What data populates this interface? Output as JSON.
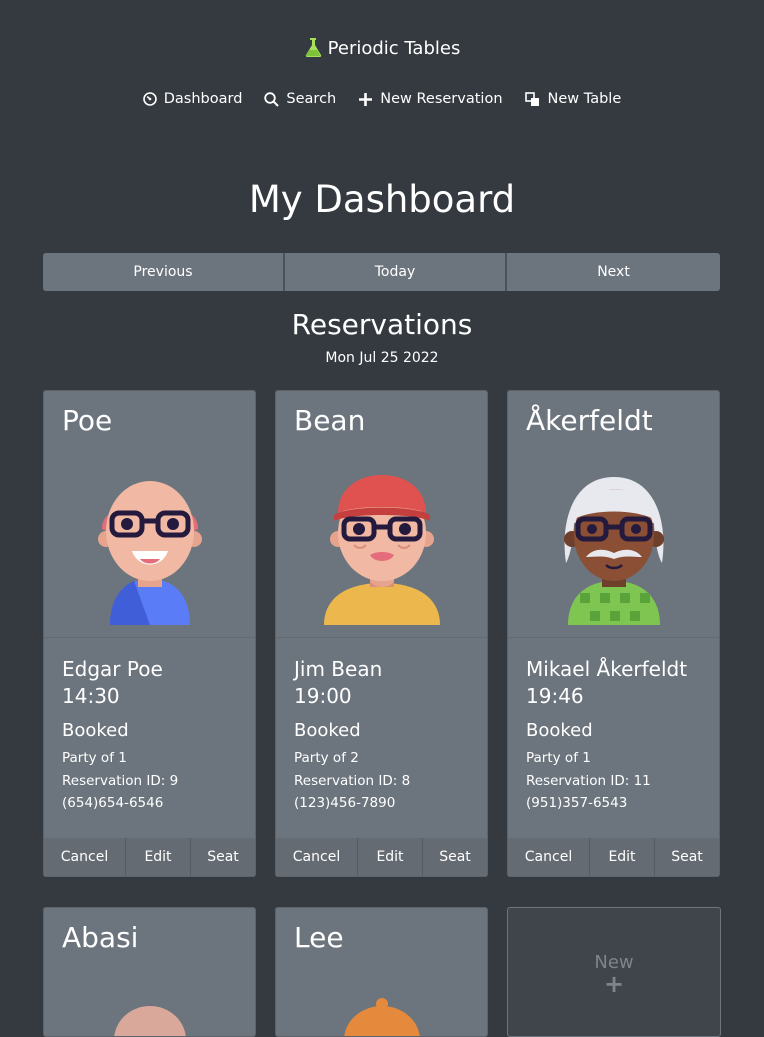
{
  "brand": {
    "title": "Periodic Tables",
    "icon": "flask-icon",
    "accent": "#a7e05a"
  },
  "nav": [
    {
      "label": "Dashboard",
      "icon": "dashboard-icon"
    },
    {
      "label": "Search",
      "icon": "search-icon"
    },
    {
      "label": "New Reservation",
      "icon": "plus-icon"
    },
    {
      "label": "New Table",
      "icon": "new-table-icon"
    }
  ],
  "page": {
    "title": "My Dashboard"
  },
  "date_nav": {
    "previous": "Previous",
    "today": "Today",
    "next": "Next"
  },
  "reservations": {
    "title": "Reservations",
    "date": "Mon Jul 25 2022",
    "cards": [
      {
        "last_name": "Poe",
        "full_name": "Edgar Poe",
        "time": "14:30",
        "status": "Booked",
        "party": "Party of 1",
        "reservation_id": "Reservation ID: 9",
        "phone": "(654)654-6546",
        "cancel": "Cancel",
        "edit": "Edit",
        "seat": "Seat"
      },
      {
        "last_name": "Bean",
        "full_name": "Jim Bean",
        "time": "19:00",
        "status": "Booked",
        "party": "Party of 2",
        "reservation_id": "Reservation ID: 8",
        "phone": "(123)456-7890",
        "cancel": "Cancel",
        "edit": "Edit",
        "seat": "Seat"
      },
      {
        "last_name": "Åkerfeldt",
        "full_name": "Mikael Åkerfeldt",
        "time": "19:46",
        "status": "Booked",
        "party": "Party of 1",
        "reservation_id": "Reservation ID: 11",
        "phone": "(951)357-6543",
        "cancel": "Cancel",
        "edit": "Edit",
        "seat": "Seat"
      },
      {
        "last_name": "Abasi"
      },
      {
        "last_name": "Lee"
      }
    ],
    "new_card": {
      "label": "New",
      "plus": "+"
    }
  },
  "colors": {
    "background": "#343a40",
    "card": "#6c757d"
  }
}
